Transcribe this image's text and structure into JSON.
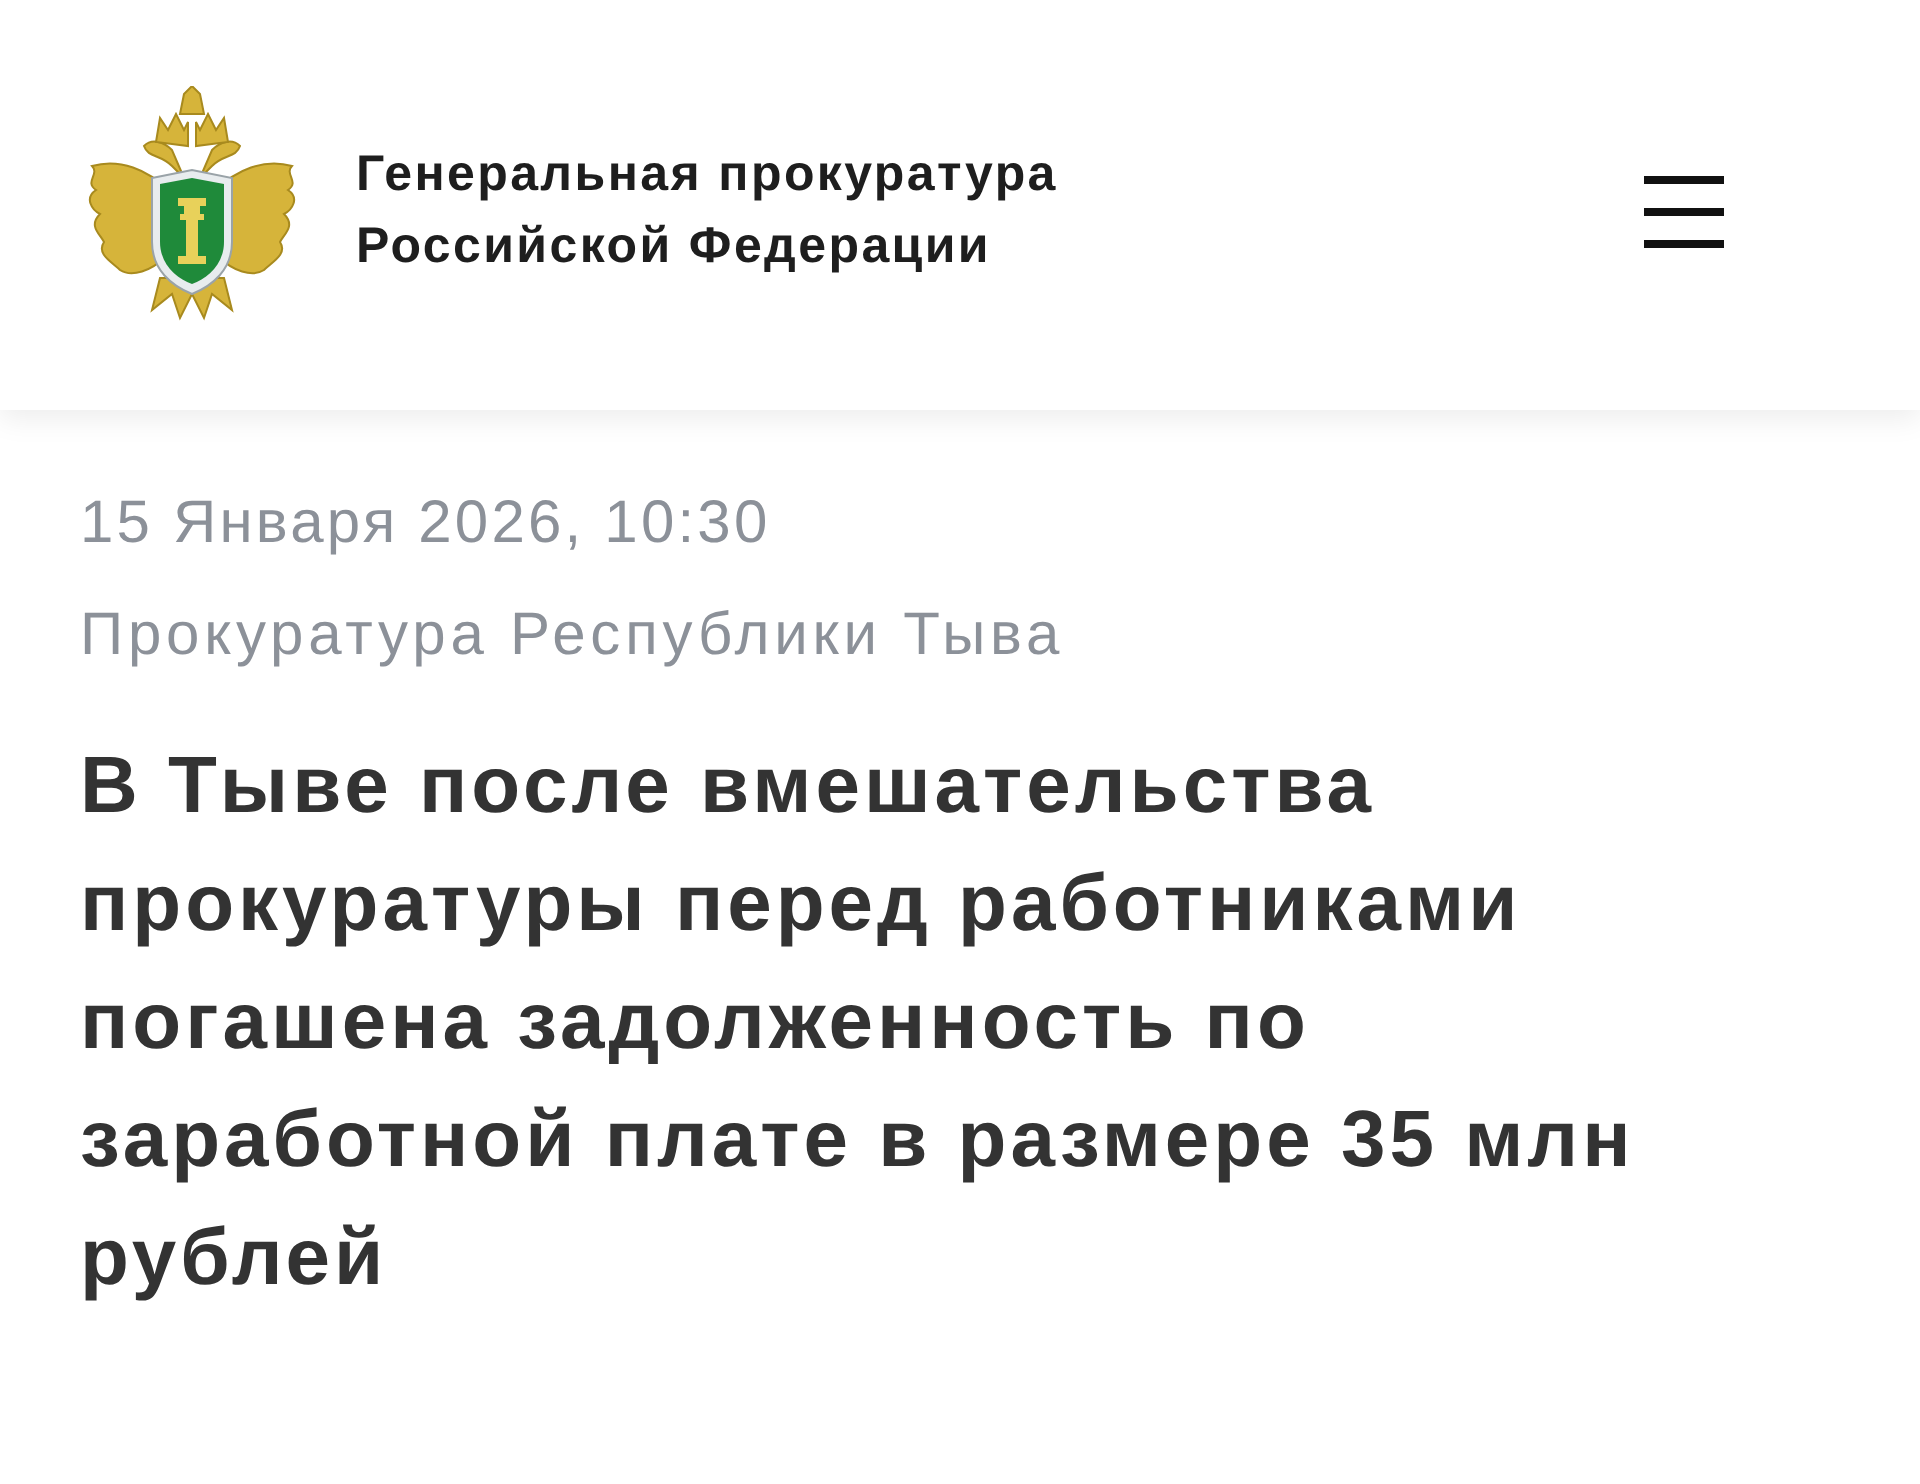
{
  "header": {
    "organization": "Генеральная прокуратура Российской Федерации"
  },
  "article": {
    "date": "15 Января 2026, 10:30",
    "source": "Прокуратура Республики Тыва",
    "headline": "В Тыве после вмешательства прокуратуры перед работниками погашена задолженность по заработной плате в размере 35 млн рублей"
  }
}
